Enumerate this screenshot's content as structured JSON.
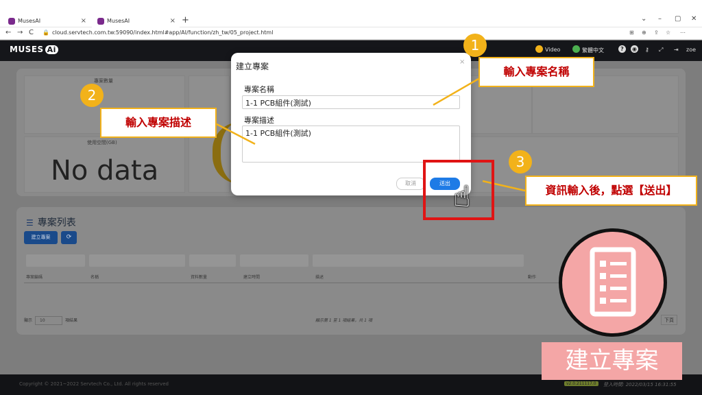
{
  "browser": {
    "tabs": [
      {
        "label": "MusesAI",
        "close": "×"
      },
      {
        "label": "MusesAI",
        "close": "×"
      }
    ],
    "new_tab": "+",
    "url": "cloud.servtech.com.tw:59090/index.html#app/AI/function/zh_tw/05_project.html",
    "window_controls": [
      "⌄",
      "–",
      "▢",
      "✕"
    ]
  },
  "header": {
    "logo_text": "MUSES",
    "logo_badge": "Ai",
    "video_label": "Video",
    "lang_label": "繁體中文",
    "user": "zoe"
  },
  "dashboard": {
    "project_count_label": "專案數量",
    "usage_label": "使用空間(GB)",
    "no_data": "No data"
  },
  "project_list": {
    "title": "專案列表",
    "create_button": "建立專案",
    "refresh_icon": "⟳",
    "columns": [
      "專案編碼",
      "名稱",
      "資料數量",
      "建立時間",
      "描述",
      "動作"
    ],
    "page_size_prefix": "顯示",
    "page_size": "10",
    "page_size_suffix": "項結果",
    "summary": "顯示第 1 至 1 項結果，共 1 項",
    "next_button": "下頁"
  },
  "footer": {
    "copyright": "Copyright © 2021~2022 Servtech Co., Ltd. All rights reserved",
    "version": "v2.0.211117.0",
    "login_time": "登入時間: 2022/03/15 16:31:55"
  },
  "modal": {
    "title": "建立專案",
    "close": "×",
    "name_label": "專案名稱",
    "name_value": "1-1 PCB組件(測試)",
    "desc_label": "專案描述",
    "desc_value": "1-1 PCB組件(測試)",
    "cancel": "取消",
    "submit": "送出"
  },
  "annotations": {
    "step1_num": "1",
    "step1_text": "輸入專案名稱",
    "step2_num": "2",
    "step2_text": "輸入專案描述",
    "step3_num": "3",
    "step3_text": "資訊輸入後，點選【送出】",
    "badge_text": "建立專案"
  },
  "colors": {
    "accent": "#f2b21a",
    "callout_text": "#c00000",
    "submit_blue": "#1e7be6",
    "highlight_red": "#e01414",
    "badge_pink": "#f4a6a6"
  }
}
